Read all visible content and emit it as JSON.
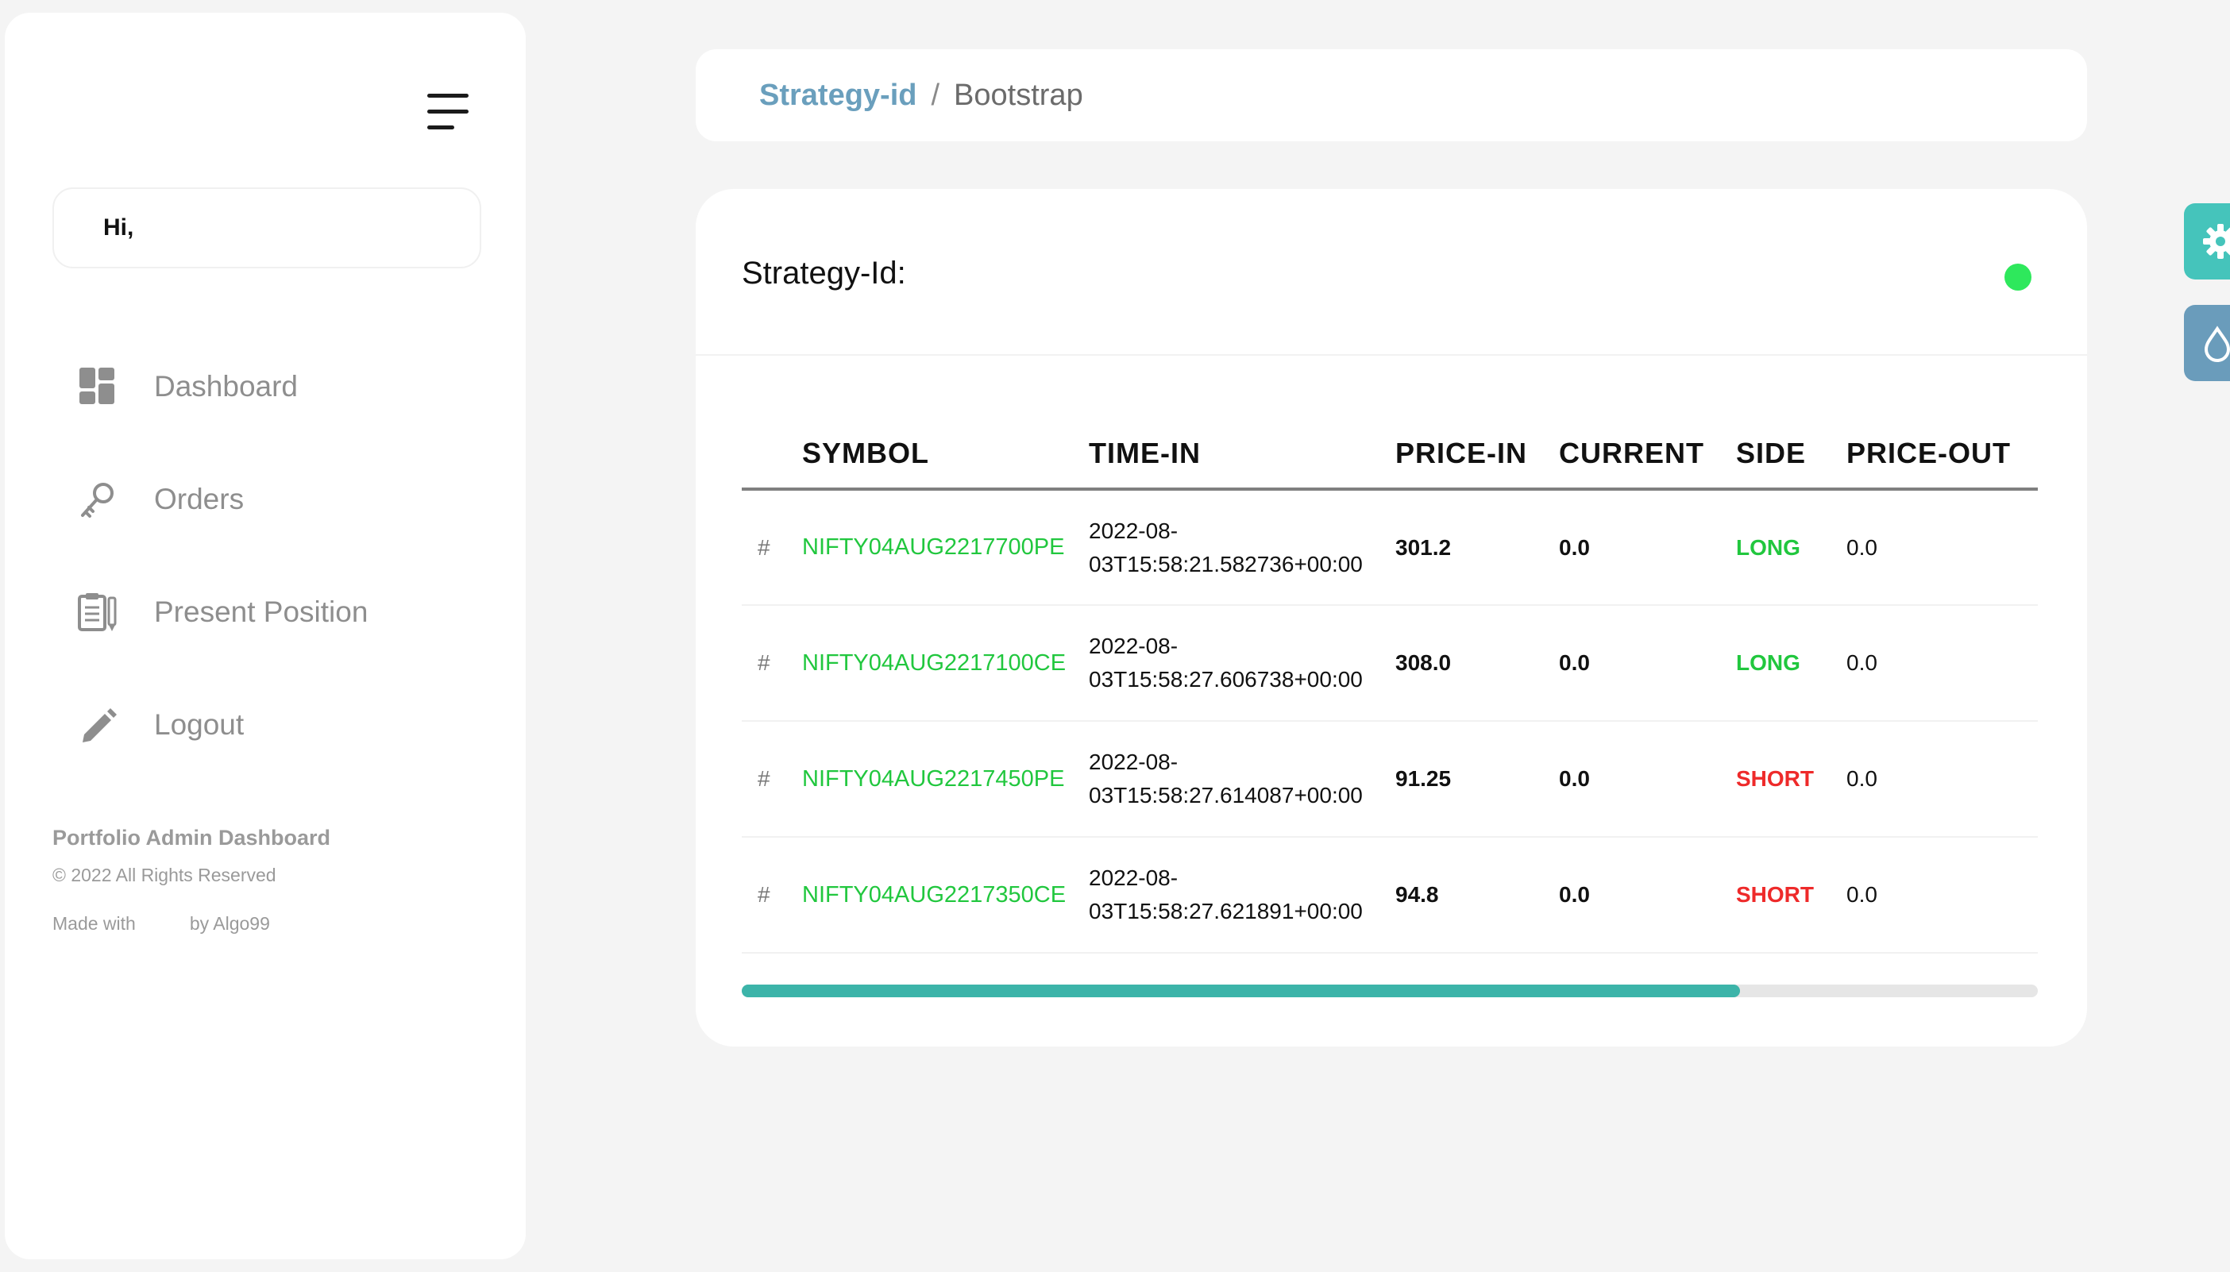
{
  "sidebar": {
    "greeting": "Hi,",
    "items": [
      {
        "label": "Dashboard",
        "icon": "dashboard-grid-icon"
      },
      {
        "label": "Orders",
        "icon": "key-icon"
      },
      {
        "label": "Present Position",
        "icon": "clipboard-icon"
      },
      {
        "label": "Logout",
        "icon": "pencil-icon"
      }
    ],
    "footer": {
      "brand": "Portfolio Admin Dashboard",
      "rights": "© 2022 All Rights Reserved",
      "made_with": "Made with",
      "by": "by Algo99"
    }
  },
  "breadcrumb": {
    "link": "Strategy-id",
    "separator": "/",
    "current": "Bootstrap"
  },
  "card": {
    "title": "Strategy-Id:",
    "status_color": "#2ee85c"
  },
  "table": {
    "columns": [
      "",
      "SYMBOL",
      "TIME-IN",
      "PRICE-IN",
      "CURRENT",
      "SIDE",
      "PRICE-OUT"
    ],
    "rows": [
      {
        "hash": "#",
        "symbol": "NIFTY04AUG2217700PE",
        "time_in_1": "2022-08-",
        "time_in_2": "03T15:58:21.582736+00:00",
        "price_in": "301.2",
        "current": "0.0",
        "side": "LONG",
        "price_out": "0.0"
      },
      {
        "hash": "#",
        "symbol": "NIFTY04AUG2217100CE",
        "time_in_1": "2022-08-",
        "time_in_2": "03T15:58:27.606738+00:00",
        "price_in": "308.0",
        "current": "0.0",
        "side": "LONG",
        "price_out": "0.0"
      },
      {
        "hash": "#",
        "symbol": "NIFTY04AUG2217450PE",
        "time_in_1": "2022-08-",
        "time_in_2": "03T15:58:27.614087+00:00",
        "price_in": "91.25",
        "current": "0.0",
        "side": "SHORT",
        "price_out": "0.0"
      },
      {
        "hash": "#",
        "symbol": "NIFTY04AUG2217350CE",
        "time_in_1": "2022-08-",
        "time_in_2": "03T15:58:27.621891+00:00",
        "price_in": "94.8",
        "current": "0.0",
        "side": "SHORT",
        "price_out": "0.0"
      }
    ],
    "scroll_position": 0.77
  },
  "floating": {
    "settings_icon": "gear-icon",
    "theme_icon": "droplet-icon"
  },
  "colors": {
    "accent": "#45c4bb",
    "link": "#6a9fbd",
    "long": "#21c73e",
    "short": "#ee2a2a"
  }
}
